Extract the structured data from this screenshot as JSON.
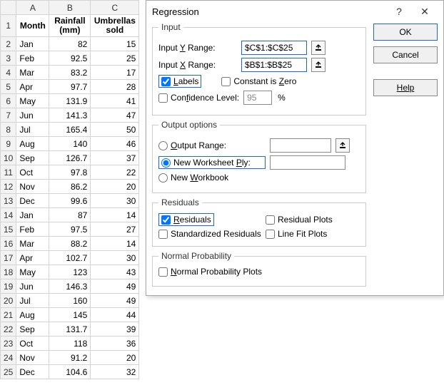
{
  "sheet": {
    "colHeaders": [
      "A",
      "B",
      "C"
    ],
    "headRow": {
      "month": "Month",
      "rainfall": "Rainfall (mm)",
      "umbrellas": "Umbrellas sold"
    },
    "rows": [
      {
        "n": 2,
        "m": "Jan",
        "r": "82",
        "u": "15"
      },
      {
        "n": 3,
        "m": "Feb",
        "r": "92.5",
        "u": "25"
      },
      {
        "n": 4,
        "m": "Mar",
        "r": "83.2",
        "u": "17"
      },
      {
        "n": 5,
        "m": "Apr",
        "r": "97.7",
        "u": "28"
      },
      {
        "n": 6,
        "m": "May",
        "r": "131.9",
        "u": "41"
      },
      {
        "n": 7,
        "m": "Jun",
        "r": "141.3",
        "u": "47"
      },
      {
        "n": 8,
        "m": "Jul",
        "r": "165.4",
        "u": "50"
      },
      {
        "n": 9,
        "m": "Aug",
        "r": "140",
        "u": "46"
      },
      {
        "n": 10,
        "m": "Sep",
        "r": "126.7",
        "u": "37"
      },
      {
        "n": 11,
        "m": "Oct",
        "r": "97.8",
        "u": "22"
      },
      {
        "n": 12,
        "m": "Nov",
        "r": "86.2",
        "u": "20"
      },
      {
        "n": 13,
        "m": "Dec",
        "r": "99.6",
        "u": "30"
      },
      {
        "n": 14,
        "m": "Jan",
        "r": "87",
        "u": "14"
      },
      {
        "n": 15,
        "m": "Feb",
        "r": "97.5",
        "u": "27"
      },
      {
        "n": 16,
        "m": "Mar",
        "r": "88.2",
        "u": "14"
      },
      {
        "n": 17,
        "m": "Apr",
        "r": "102.7",
        "u": "30"
      },
      {
        "n": 18,
        "m": "May",
        "r": "123",
        "u": "43"
      },
      {
        "n": 19,
        "m": "Jun",
        "r": "146.3",
        "u": "49"
      },
      {
        "n": 20,
        "m": "Jul",
        "r": "160",
        "u": "49"
      },
      {
        "n": 21,
        "m": "Aug",
        "r": "145",
        "u": "44"
      },
      {
        "n": 22,
        "m": "Sep",
        "r": "131.7",
        "u": "39"
      },
      {
        "n": 23,
        "m": "Oct",
        "r": "118",
        "u": "36"
      },
      {
        "n": 24,
        "m": "Nov",
        "r": "91.2",
        "u": "20"
      },
      {
        "n": 25,
        "m": "Dec",
        "r": "104.6",
        "u": "32"
      }
    ]
  },
  "dialog": {
    "title": "Regression",
    "buttons": {
      "ok": "OK",
      "cancel": "Cancel",
      "help": "Help"
    },
    "input": {
      "legend": "Input",
      "yLabel": "Input Y Range:",
      "yLabelU": "Y",
      "xLabel": "Input X Range:",
      "xLabelU": "X",
      "yVal": "$C$1:$C$25",
      "xVal": "$B$1:$B$25",
      "labels": "Labels",
      "labelsU": "L",
      "constZero": "Constant is Zero",
      "constZeroU": "Z",
      "confLevel": "Confidence Level:",
      "confLevelU": "f",
      "confVal": "95",
      "pct": "%"
    },
    "output": {
      "legend": "Output options",
      "outputRange": "Output Range:",
      "outputRangeU": "O",
      "newPly": "New Worksheet Ply:",
      "newPlyU": "P",
      "newWb": "New Workbook",
      "newWbU": "W"
    },
    "residuals": {
      "legend": "Residuals",
      "residuals": "Residuals",
      "residualsU": "R",
      "residPlots": "Residual Plots",
      "stdResid": "Standardized Residuals",
      "lineFit": "Line Fit Plots"
    },
    "normal": {
      "legend": "Normal Probability",
      "npp": "Normal Probability Plots",
      "nppU": "N"
    }
  }
}
